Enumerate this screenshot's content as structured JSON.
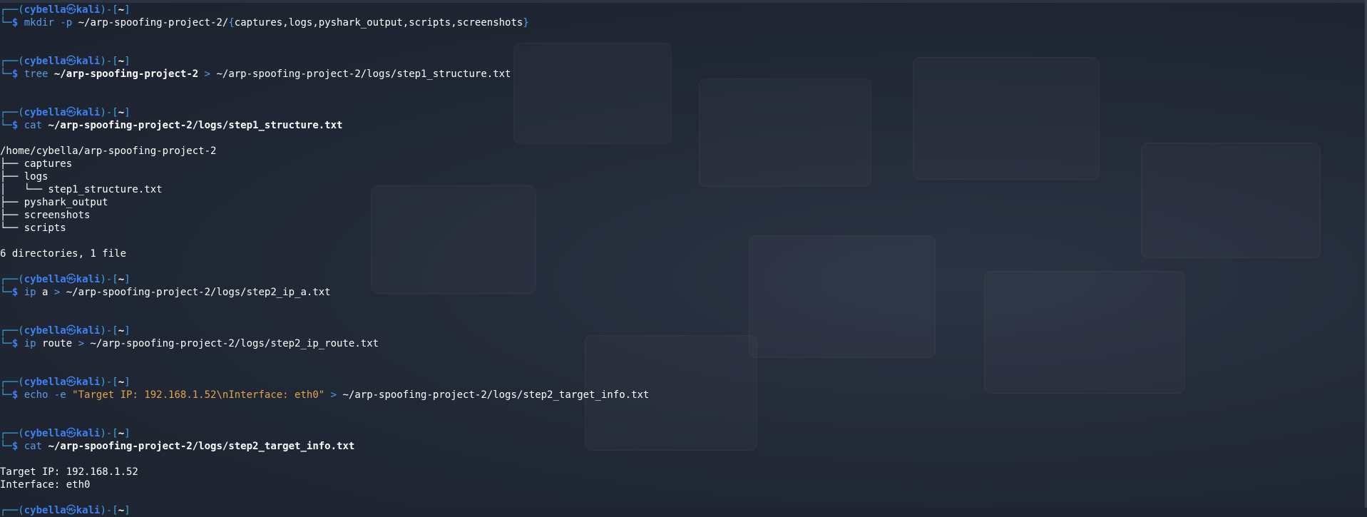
{
  "prompt": {
    "open": "┌──(",
    "user": "cybella",
    "at": "㉿",
    "host": "kali",
    "close": ")-[",
    "dir": "~",
    "end": "]",
    "arrow": "└─",
    "dollar": "$"
  },
  "blocks": [
    {
      "cmd": "mkdir",
      "args": [
        {
          "t": " -p ",
          "c": "op"
        },
        {
          "t": "~/arp-spoofing-project-2/",
          "c": "arg"
        },
        {
          "t": "{",
          "c": "op"
        },
        {
          "t": "captures,logs,pyshark_output,scripts,screenshots",
          "c": "arg"
        },
        {
          "t": "}",
          "c": "op"
        }
      ],
      "output": []
    },
    {
      "cmd": "tree",
      "args": [
        {
          "t": " ~/arp-spoofing-project-2",
          "c": "bold"
        },
        {
          "t": " > ",
          "c": "op"
        },
        {
          "t": "~/arp-spoofing-project-2/logs/step1_structure.txt",
          "c": "arg"
        }
      ],
      "output": []
    },
    {
      "cmd": "cat",
      "args": [
        {
          "t": " ~/arp-spoofing-project-2/logs/step1_structure.txt",
          "c": "bold"
        }
      ],
      "output": [
        "/home/cybella/arp-spoofing-project-2",
        "├── captures",
        "├── logs",
        "│   └── step1_structure.txt",
        "├── pyshark_output",
        "├── screenshots",
        "└── scripts",
        "",
        "6 directories, 1 file"
      ]
    },
    {
      "cmd": "ip",
      "args": [
        {
          "t": " a",
          "c": "arg"
        },
        {
          "t": " > ",
          "c": "op"
        },
        {
          "t": "~/arp-spoofing-project-2/logs/step2_ip_a.txt",
          "c": "arg"
        }
      ],
      "output": []
    },
    {
      "cmd": "ip",
      "args": [
        {
          "t": " route",
          "c": "arg"
        },
        {
          "t": " > ",
          "c": "op"
        },
        {
          "t": "~/arp-spoofing-project-2/logs/step2_ip_route.txt",
          "c": "arg"
        }
      ],
      "output": []
    },
    {
      "cmd": "echo",
      "args": [
        {
          "t": " -e ",
          "c": "op"
        },
        {
          "t": "\"Target IP: 192.168.1.52\\nInterface: eth0\"",
          "c": "str"
        },
        {
          "t": " > ",
          "c": "op"
        },
        {
          "t": "~/arp-spoofing-project-2/logs/step2_target_info.txt",
          "c": "arg"
        }
      ],
      "output": []
    },
    {
      "cmd": "cat",
      "args": [
        {
          "t": " ~/arp-spoofing-project-2/logs/step2_target_info.txt",
          "c": "bold"
        }
      ],
      "output": [
        "Target IP: 192.168.1.52",
        "Interface: eth0"
      ]
    }
  ],
  "colors": {
    "background": "#1e2430",
    "prompt_frame": "#3aa6e3",
    "prompt_user": "#3b82f6",
    "command": "#5a9bea",
    "string": "#e0a64a",
    "text": "#ffffff"
  }
}
